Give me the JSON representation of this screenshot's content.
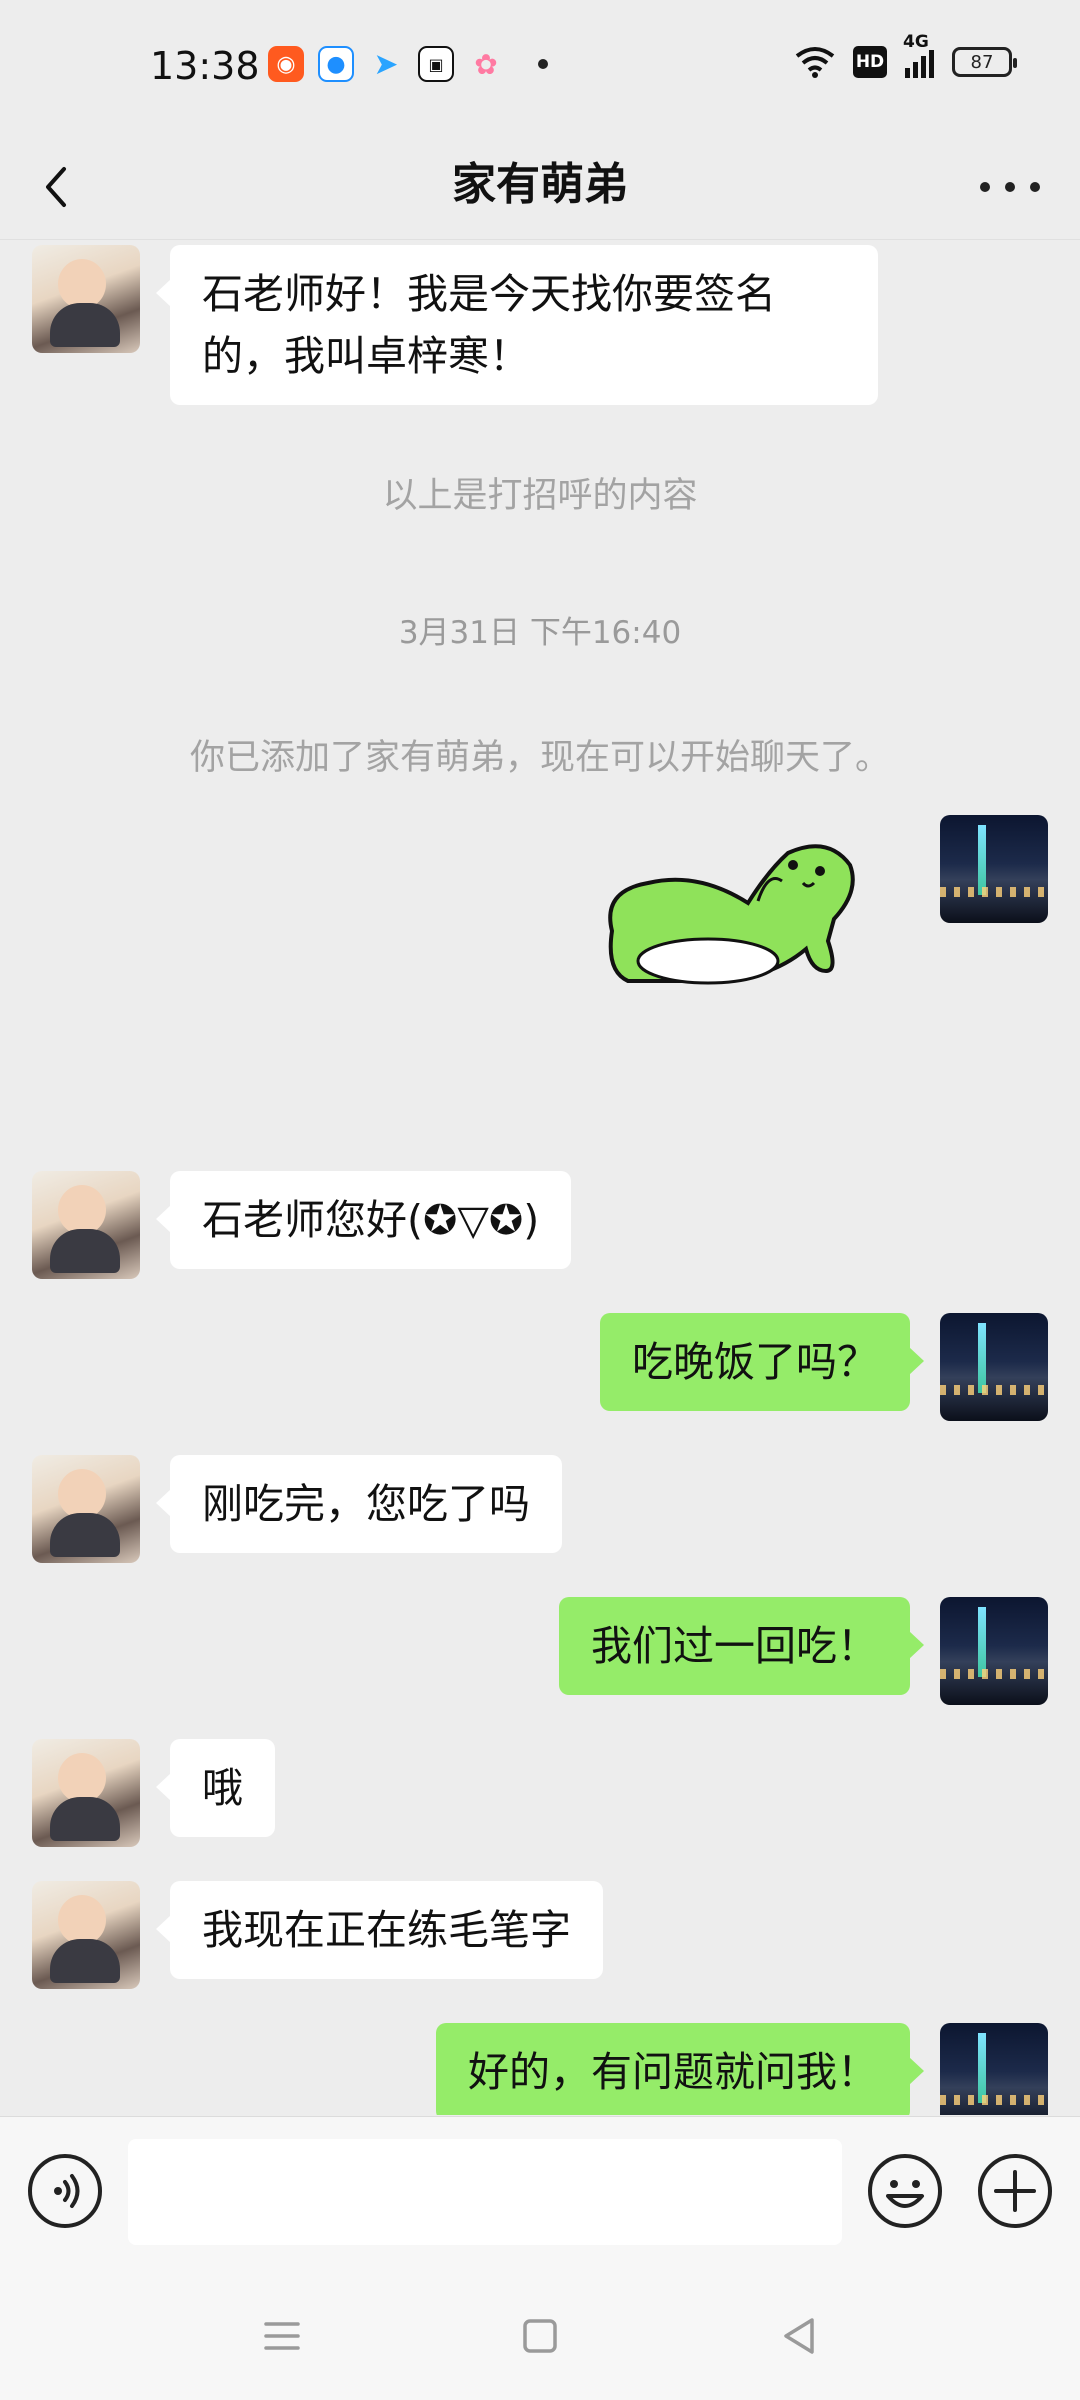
{
  "status_bar": {
    "time": "13:38",
    "apps": [
      {
        "icon": "kuaishou-icon",
        "color": "#ff5a1f"
      },
      {
        "icon": "browser-icon",
        "color": "#1e8fff"
      },
      {
        "icon": "send-icon",
        "color": "#2aa4ff"
      },
      {
        "icon": "video-app-icon",
        "color": "#111111"
      },
      {
        "icon": "cloud-app-icon",
        "color": "#ff7aa2"
      }
    ],
    "hd": "HD",
    "network": "4G",
    "battery": "87"
  },
  "nav": {
    "title": "家有萌弟"
  },
  "chat": {
    "messages": [
      {
        "side": "left",
        "text": "石老师好！我是今天找你要签名的，我叫卓梓寒！"
      },
      {
        "side": "system",
        "text": "以上是打招呼的内容"
      },
      {
        "side": "time",
        "text": "3月31日 下午16:40"
      },
      {
        "side": "system",
        "text": "你已添加了家有萌弟，现在可以开始聊天了。"
      },
      {
        "side": "right",
        "type": "sticker",
        "sticker": "green-seal-sticker"
      },
      {
        "side": "left",
        "text": "石老师您好(✪▽✪)"
      },
      {
        "side": "right",
        "text": "吃晚饭了吗？"
      },
      {
        "side": "left",
        "text": "刚吃完，您吃了吗"
      },
      {
        "side": "right",
        "text": "我们过一回吃！"
      },
      {
        "side": "left",
        "text": "哦"
      },
      {
        "side": "left",
        "text": "我现在正在练毛笔字"
      },
      {
        "side": "right",
        "text": "好的，有问题就问我！"
      }
    ]
  },
  "colors": {
    "background": "#ededed",
    "bubble_self": "#95ec69",
    "bubble_other": "#ffffff",
    "sticker_green": "#8fe25a"
  }
}
